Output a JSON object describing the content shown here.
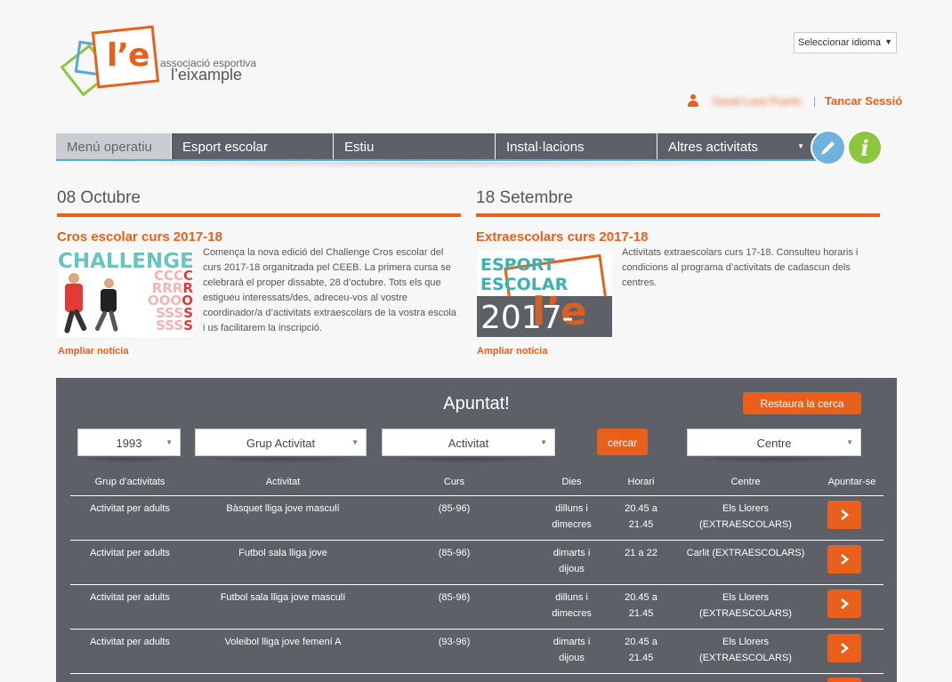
{
  "logo": {
    "mark": "l’e",
    "line1": "associació esportiva",
    "line2": "l’eixample"
  },
  "language_select": {
    "value": "Seleccionar idioma"
  },
  "user": {
    "name": "David Luna Puerto",
    "separator": "|",
    "logout_label": "Tancar Sessió"
  },
  "nav": {
    "items": [
      {
        "label": "Menú operatiu"
      },
      {
        "label": "Esport escolar"
      },
      {
        "label": "Estiu"
      },
      {
        "label": "Instal·lacions"
      },
      {
        "label": "Altres activitats"
      }
    ]
  },
  "icons": {
    "pen": "pen-icon",
    "info": "info-icon",
    "info_glyph": "i",
    "user": "user-icon",
    "chevron": "chevron-right-icon"
  },
  "news": [
    {
      "date": "08 Octubre",
      "title": "Cros escolar curs 2017-18",
      "text": "Comença la nova edició del Challenge Cros escolar del curs 2017-18 organitzada pel CEEB. La primera cursa se celebrarà el proper dissabte, 28 d’octubre. Tots els que estigueu interessats/des, adreceu-vos al vostre coordinador/a d’activitats extraescolars de la vostra escola i us facilitarem la inscripció.",
      "more": "Ampliar notícia",
      "image_text": "CHALLENGE"
    },
    {
      "date": "18 Setembre",
      "title": "Extraescolars curs 2017-18",
      "text": "Activitats extraescolars curs 17-18. Consulteu horaris i condicions al programa d’activitats de cadascun dels centres.",
      "more": "Ampliar notícia",
      "image_text_1": "ESPORT",
      "image_text_2": "ESCOLAR",
      "image_year": "2017-18"
    }
  ],
  "search": {
    "heading": "Apuntat!",
    "reset_label": "Restaura la cerca",
    "search_label": "cercar",
    "year": "1993",
    "group": "Grup Activitat",
    "activity": "Activitat",
    "centre": "Centre"
  },
  "table": {
    "headers": [
      "Grup d’activitats",
      "Activitat",
      "Curs",
      "Dies",
      "Horari",
      "Centre",
      "Apuntar-se"
    ],
    "rows": [
      {
        "group": "Activitat per adults",
        "activity": "Bàsquet lliga jove masculí",
        "course": "(85-96)",
        "days_1": "dilluns i",
        "days_2": "dimecres",
        "time_1": "20.45 a",
        "time_2": "21.45",
        "centre_1": "Els Llorers",
        "centre_2": "(EXTRAESCOLARS)"
      },
      {
        "group": "Activitat per adults",
        "activity": "Futbol sala lliga jove",
        "course": "(85-96)",
        "days_1": "dimarts i",
        "days_2": "dijous",
        "time_1": "21 a 22",
        "time_2": "",
        "centre_1": "Carlit (EXTRAESCOLARS)",
        "centre_2": ""
      },
      {
        "group": "Activitat per adults",
        "activity": "Futbol sala lliga jove masculí",
        "course": "(85-96)",
        "days_1": "dilluns i",
        "days_2": "dimecres",
        "time_1": "20.45 a",
        "time_2": "21.45",
        "centre_1": "Els Llorers",
        "centre_2": "(EXTRAESCOLARS)"
      },
      {
        "group": "Activitat per adults",
        "activity": "Voleibol lliga jove femení A",
        "course": "(93-96)",
        "days_1": "dimarts i",
        "days_2": "dijous",
        "time_1": "20.45 a",
        "time_2": "21.45",
        "centre_1": "Els Llorers",
        "centre_2": "(EXTRAESCOLARS)"
      }
    ]
  },
  "colors": {
    "accent": "#e8601c",
    "nav": "#5e6068",
    "blue": "#5aa6d6",
    "green": "#8cc63f"
  }
}
